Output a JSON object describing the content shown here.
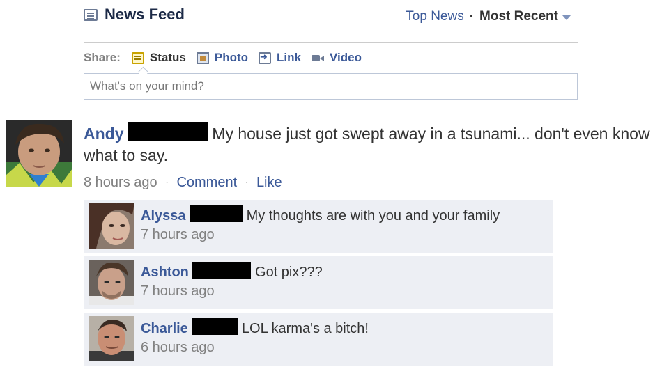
{
  "header": {
    "title": "News Feed",
    "sort": {
      "top_news": "Top News",
      "separator": "·",
      "most_recent": "Most Recent"
    }
  },
  "share": {
    "label": "Share:",
    "items": [
      {
        "label": "Status",
        "icon": "status-icon"
      },
      {
        "label": "Photo",
        "icon": "photo-icon"
      },
      {
        "label": "Link",
        "icon": "link-icon"
      },
      {
        "label": "Video",
        "icon": "video-icon"
      }
    ],
    "placeholder": "What's on your mind?"
  },
  "story": {
    "author": "Andy",
    "text": "My house just got swept away in a tsunami... don't even know what to say.",
    "time": "8 hours ago",
    "comment_label": "Comment",
    "like_label": "Like",
    "separator": "·"
  },
  "comments": [
    {
      "author": "Alyssa",
      "text": "My thoughts are with you and your family",
      "time": "7 hours ago"
    },
    {
      "author": "Ashton",
      "text": "Got pix???",
      "time": "7 hours ago"
    },
    {
      "author": "Charlie",
      "text": "LOL karma's a bitch!",
      "time": "6 hours ago"
    }
  ],
  "colors": {
    "link": "#3b5998",
    "comment_bg": "#edeff4",
    "meta_text": "#808080",
    "redaction": "#000000"
  }
}
